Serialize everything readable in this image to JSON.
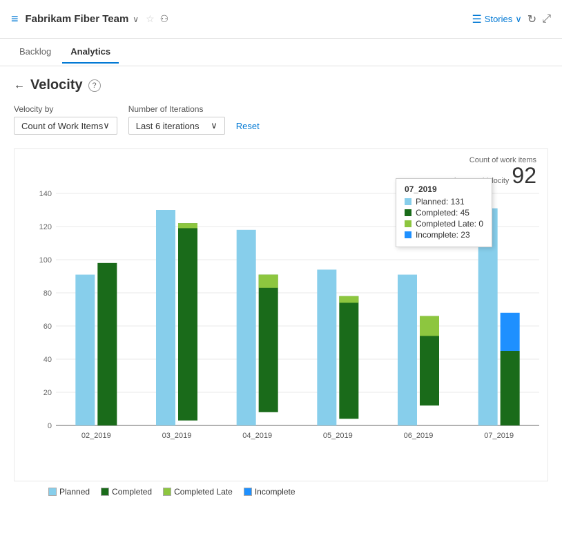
{
  "header": {
    "icon": "≡",
    "title": "Fabrikam Fiber Team",
    "chevron": "∨",
    "star": "☆",
    "team_icon": "⚇",
    "stories_label": "Stories",
    "refresh_icon": "↻",
    "expand_icon": "⤢"
  },
  "nav": {
    "tabs": [
      {
        "id": "backlog",
        "label": "Backlog",
        "active": false
      },
      {
        "id": "analytics",
        "label": "Analytics",
        "active": true
      }
    ]
  },
  "page": {
    "back_icon": "←",
    "title": "Velocity",
    "help_icon": "?"
  },
  "filters": {
    "velocity_by_label": "Velocity by",
    "velocity_by_value": "Count of Work Items",
    "iterations_label": "Number of Iterations",
    "iterations_value": "Last 6 iterations",
    "reset_label": "Reset"
  },
  "chart": {
    "metric_label": "Count of work items",
    "velocity_label": "Average Velocity",
    "velocity_value": "92",
    "y_axis": [
      0,
      20,
      40,
      60,
      80,
      100,
      120,
      140
    ],
    "colors": {
      "planned": "#87CEEB",
      "completed": "#1a6b1a",
      "completed_late": "#8dc63f",
      "incomplete": "#1e90ff"
    },
    "bars": [
      {
        "label": "02_2019",
        "planned": 91,
        "completed": 98,
        "completed_late": 0,
        "incomplete": 0
      },
      {
        "label": "03_2019",
        "planned": 130,
        "completed": 119,
        "completed_late": 3,
        "incomplete": 0
      },
      {
        "label": "04_2019",
        "planned": 118,
        "completed": 83,
        "completed_late": 8,
        "incomplete": 0
      },
      {
        "label": "05_2019",
        "planned": 94,
        "completed": 74,
        "completed_late": 4,
        "incomplete": 0
      },
      {
        "label": "06_2019",
        "planned": 91,
        "completed": 54,
        "completed_late": 12,
        "incomplete": 0
      },
      {
        "label": "07_2019",
        "planned": 131,
        "completed": 45,
        "completed_late": 0,
        "incomplete": 23
      }
    ],
    "tooltip": {
      "visible": true,
      "sprint": "07_2019",
      "rows": [
        {
          "color": "#87CEEB",
          "label": "Planned: 131"
        },
        {
          "color": "#1a6b1a",
          "label": "Completed: 45"
        },
        {
          "color": "#8dc63f",
          "label": "Completed Late: 0"
        },
        {
          "color": "#1e90ff",
          "label": "Incomplete: 23"
        }
      ]
    },
    "legend": [
      {
        "id": "planned",
        "color": "#87CEEB",
        "label": "Planned"
      },
      {
        "id": "completed",
        "color": "#1a6b1a",
        "label": "Completed"
      },
      {
        "id": "completed_late",
        "color": "#8dc63f",
        "label": "Completed Late"
      },
      {
        "id": "incomplete",
        "color": "#1e90ff",
        "label": "Incomplete"
      }
    ]
  }
}
